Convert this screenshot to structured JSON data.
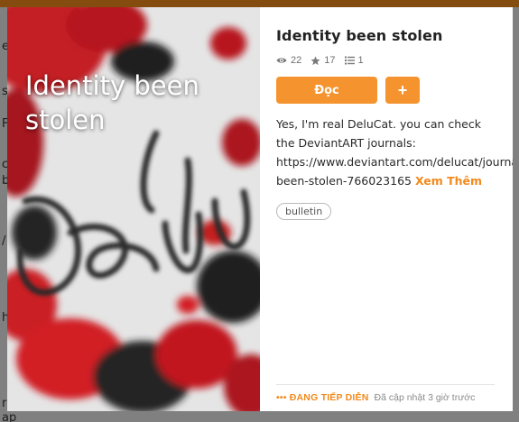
{
  "story": {
    "title": "Identity been stolen",
    "cover_title": "Identity been stolen",
    "stats": {
      "reads": "22",
      "votes": "17",
      "parts": "1"
    },
    "read_label": "Đọc",
    "add_label": "+",
    "description_lines": [
      "Yes, I'm real DeluCat. you can check",
      "the DeviantART journals:",
      "https://www.deviantart.com/delucat/journal/Identity-",
      "been-stolen-766023165"
    ],
    "see_more": "Xem Thêm",
    "tags": [
      "bulletin"
    ],
    "status": "••• ĐANG TIẾP DIỄN",
    "updated": "Đã cập nhật 3 giờ trước"
  },
  "background": {
    "fragments": [
      "e",
      "s",
      "F",
      "c",
      "b",
      "/",
      "h",
      "r",
      "ap"
    ]
  },
  "colors": {
    "accent": "#f5942e",
    "brand_orange": "#f28a1c"
  },
  "icons": {
    "reads": "eye-icon",
    "votes": "star-icon",
    "parts": "list-icon",
    "status": "ellipsis-icon"
  }
}
